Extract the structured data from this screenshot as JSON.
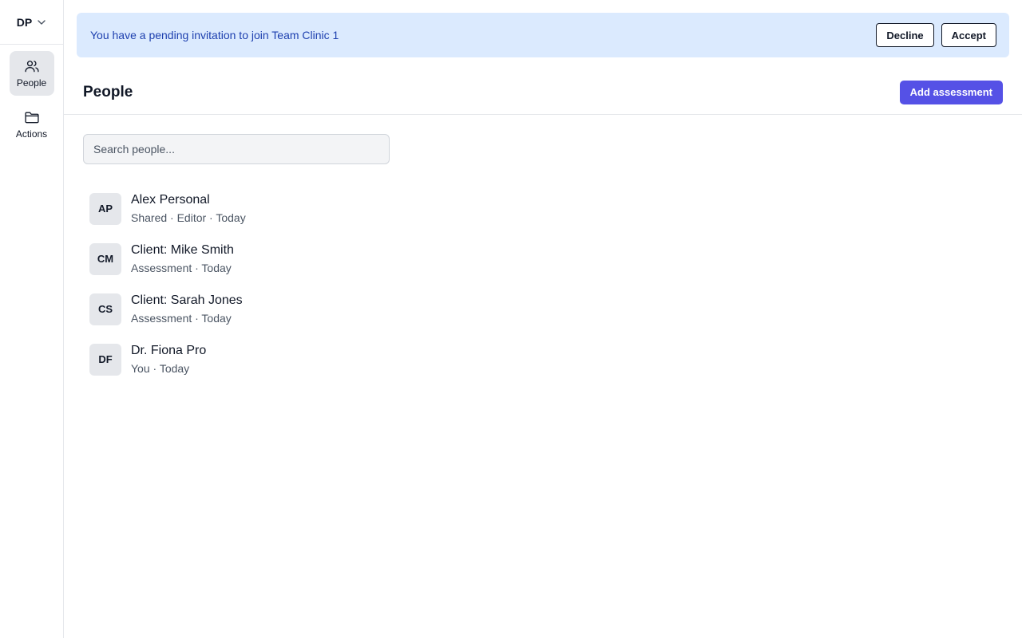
{
  "account": {
    "initials": "DP",
    "chevron_icon": "chevron-down-icon"
  },
  "sidebar": {
    "items": [
      {
        "label": "People",
        "icon": "users-icon",
        "active": true
      },
      {
        "label": "Actions",
        "icon": "folder-icon",
        "active": false
      }
    ]
  },
  "banner": {
    "message": "You have a pending invitation to join Team Clinic 1",
    "decline_label": "Decline",
    "accept_label": "Accept"
  },
  "header": {
    "title": "People",
    "add_label": "Add assessment"
  },
  "search": {
    "placeholder": "Search people...",
    "value": ""
  },
  "people": [
    {
      "initials": "AP",
      "name": "Alex Personal",
      "meta": "Shared · Editor · Today"
    },
    {
      "initials": "CM",
      "name": "Client: Mike Smith",
      "meta": "Assessment · Today"
    },
    {
      "initials": "CS",
      "name": "Client: Sarah Jones",
      "meta": "Assessment · Today"
    },
    {
      "initials": "DF",
      "name": "Dr. Fiona Pro",
      "meta": "You · Today"
    }
  ],
  "colors": {
    "accent": "#5551e6",
    "banner_bg": "#dbeafe",
    "banner_text": "#1e40af",
    "avatar_bg": "#e5e7eb",
    "nav_active_bg": "#e5e7eb"
  }
}
